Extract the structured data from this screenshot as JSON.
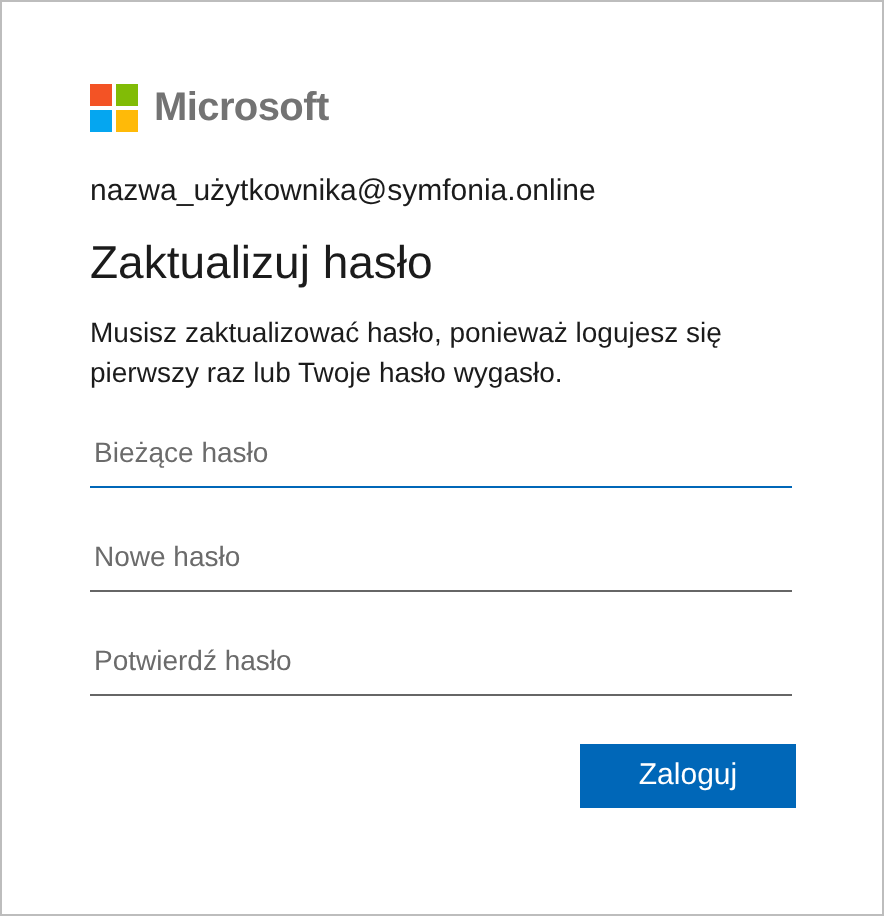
{
  "logo": {
    "text": "Microsoft"
  },
  "account": "nazwa_użytkownika@symfonia.online",
  "title": "Zaktualizuj hasło",
  "message": "Musisz zaktualizować hasło, ponieważ logujesz się pierwszy raz lub Twoje hasło wygasło.",
  "fields": [
    {
      "placeholder": "Bieżące hasło",
      "focused": true
    },
    {
      "placeholder": "Nowe hasło",
      "focused": false
    },
    {
      "placeholder": "Potwierdź hasło",
      "focused": false
    }
  ],
  "buttons": [
    "Zaloguj"
  ]
}
